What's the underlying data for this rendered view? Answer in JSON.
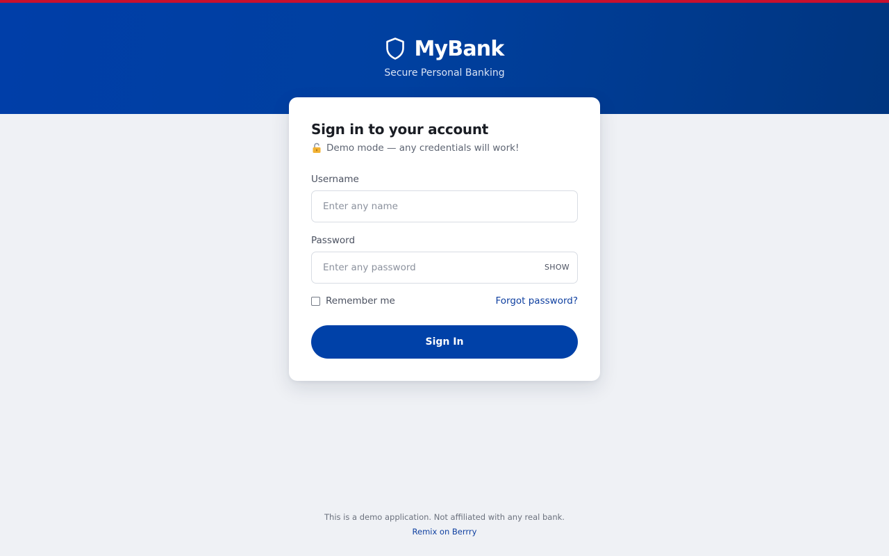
{
  "brand": {
    "name": "MyBank",
    "tagline": "Secure Personal Banking",
    "icon": "shield-icon"
  },
  "colors": {
    "top_strip": "#c8102e",
    "hero": "#0040a0",
    "primary": "#0041a8",
    "link": "#0e3fa0",
    "page_bg": "#eff1f5"
  },
  "login": {
    "title": "Sign in to your account",
    "demo_icon": "lock-icon",
    "demo_note": "Demo mode — any credentials will work!",
    "username": {
      "label": "Username",
      "placeholder": "Enter any name",
      "value": ""
    },
    "password": {
      "label": "Password",
      "placeholder": "Enter any password",
      "value": "",
      "toggle_label": "SHOW"
    },
    "remember_label": "Remember me",
    "remember_checked": false,
    "forgot_label": "Forgot password?",
    "submit_label": "Sign In"
  },
  "footer": {
    "note": "This is a demo application. Not affiliated with any real bank.",
    "link_label": "Remix on Berrry"
  }
}
